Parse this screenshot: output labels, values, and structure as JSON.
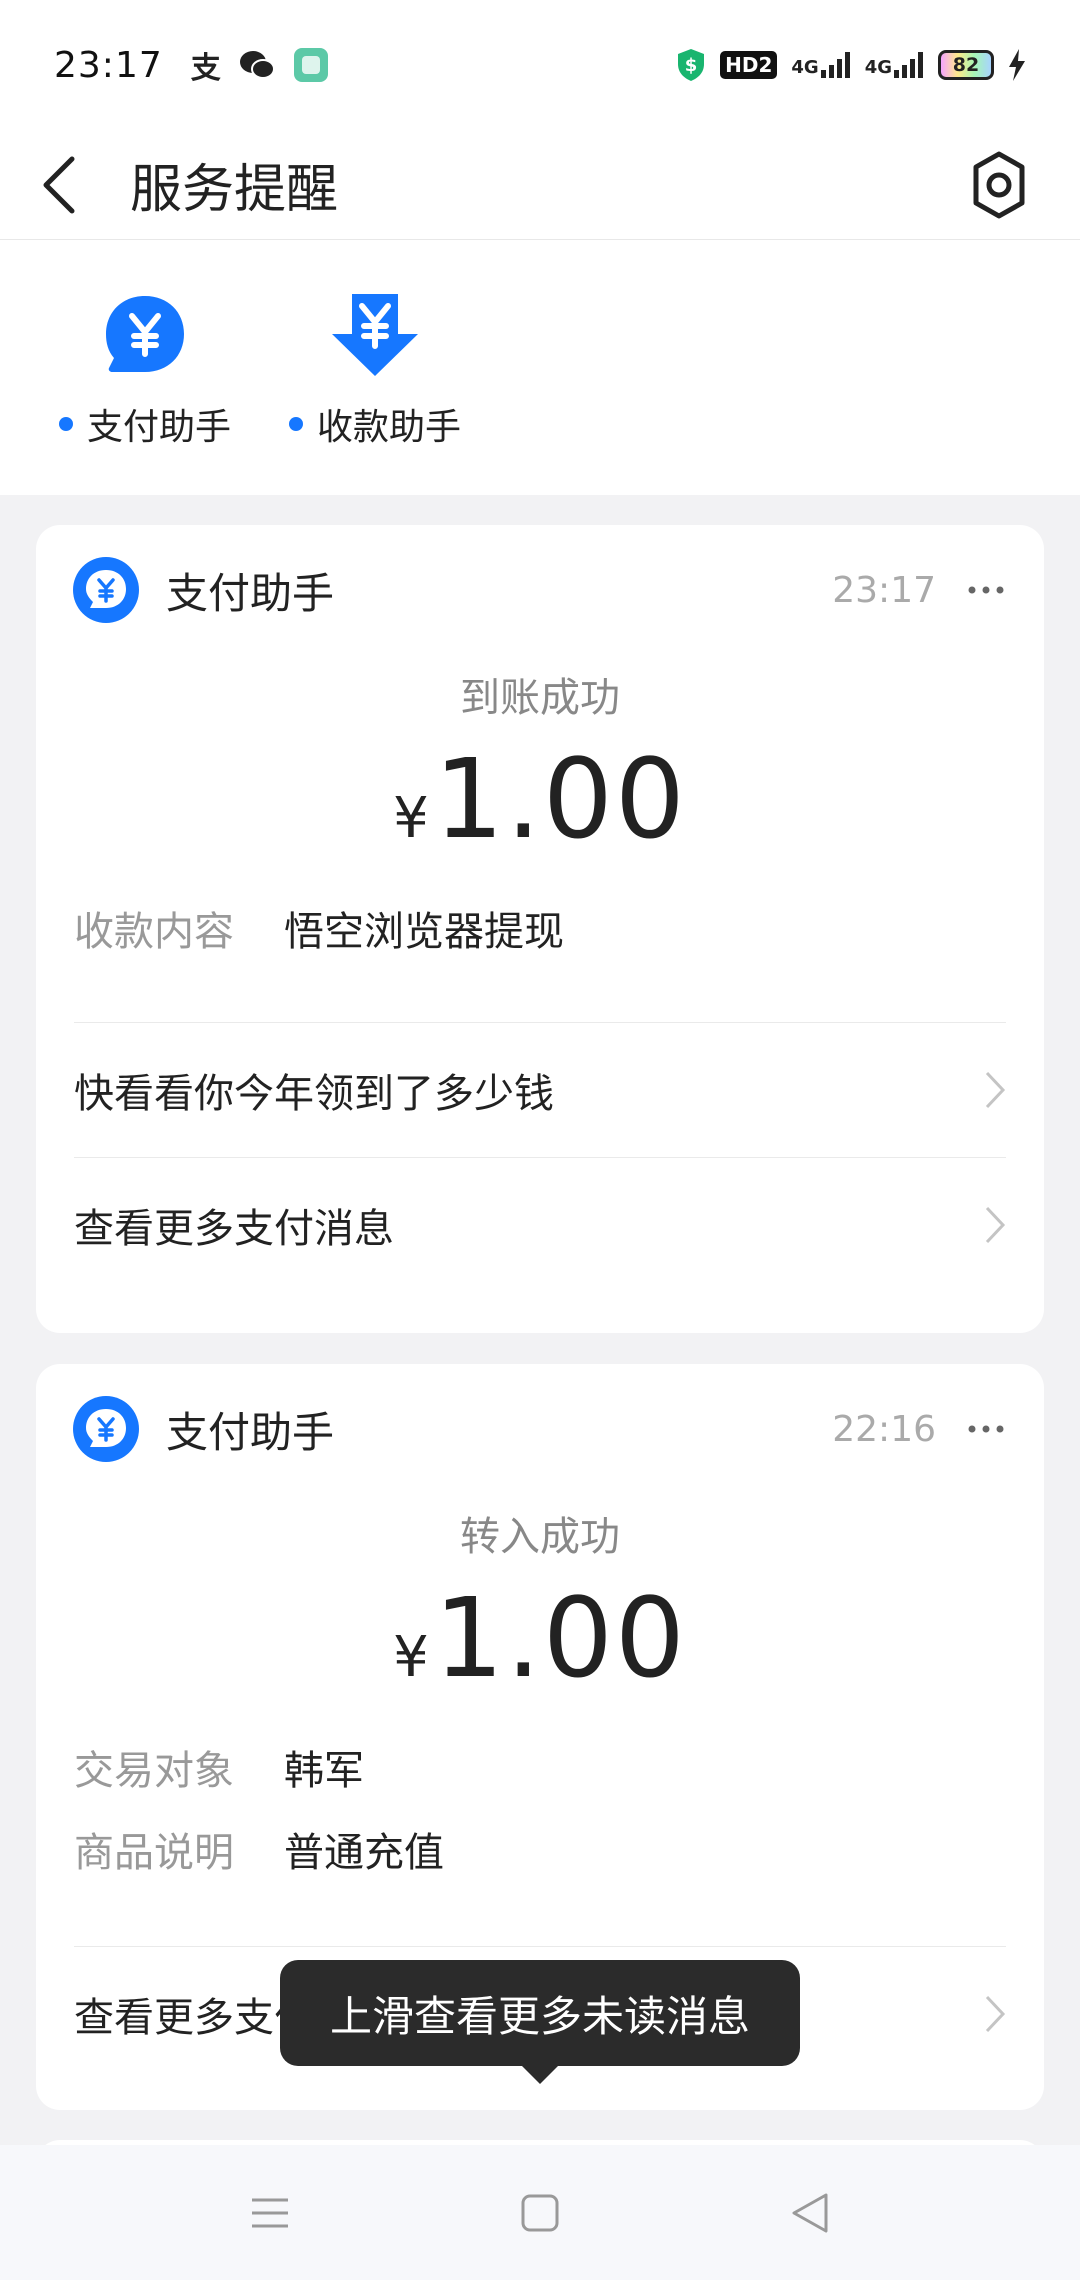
{
  "status_bar": {
    "time": "23:17",
    "left_icons": [
      "alipay-icon",
      "wechat-icon",
      "app-icon"
    ],
    "hd": "HD2",
    "net1": "4G",
    "net2": "4G",
    "battery": "82"
  },
  "header": {
    "title": "服务提醒"
  },
  "shortcuts": [
    {
      "label": "支付助手"
    },
    {
      "label": "收款助手"
    }
  ],
  "cards": [
    {
      "name": "支付助手",
      "time": "23:17",
      "status": "到账成功",
      "currency": "¥",
      "amount": "1.00",
      "details": [
        {
          "key": "收款内容",
          "value": "悟空浏览器提现"
        }
      ],
      "links": [
        "快看看你今年领到了多少钱",
        "查看更多支付消息"
      ]
    },
    {
      "name": "支付助手",
      "time": "22:16",
      "status": "转入成功",
      "currency": "¥",
      "amount": "1.00",
      "details": [
        {
          "key": "交易对象",
          "value": "韩军"
        },
        {
          "key": "商品说明",
          "value": "普通充值"
        }
      ],
      "links": [
        "查看更多支付消息"
      ]
    }
  ],
  "toast": {
    "text": "上滑查看更多未读消息"
  },
  "colors": {
    "accent": "#1677ff",
    "background": "#f2f2f4",
    "card": "#ffffff",
    "toast": "#2b2b2b"
  }
}
